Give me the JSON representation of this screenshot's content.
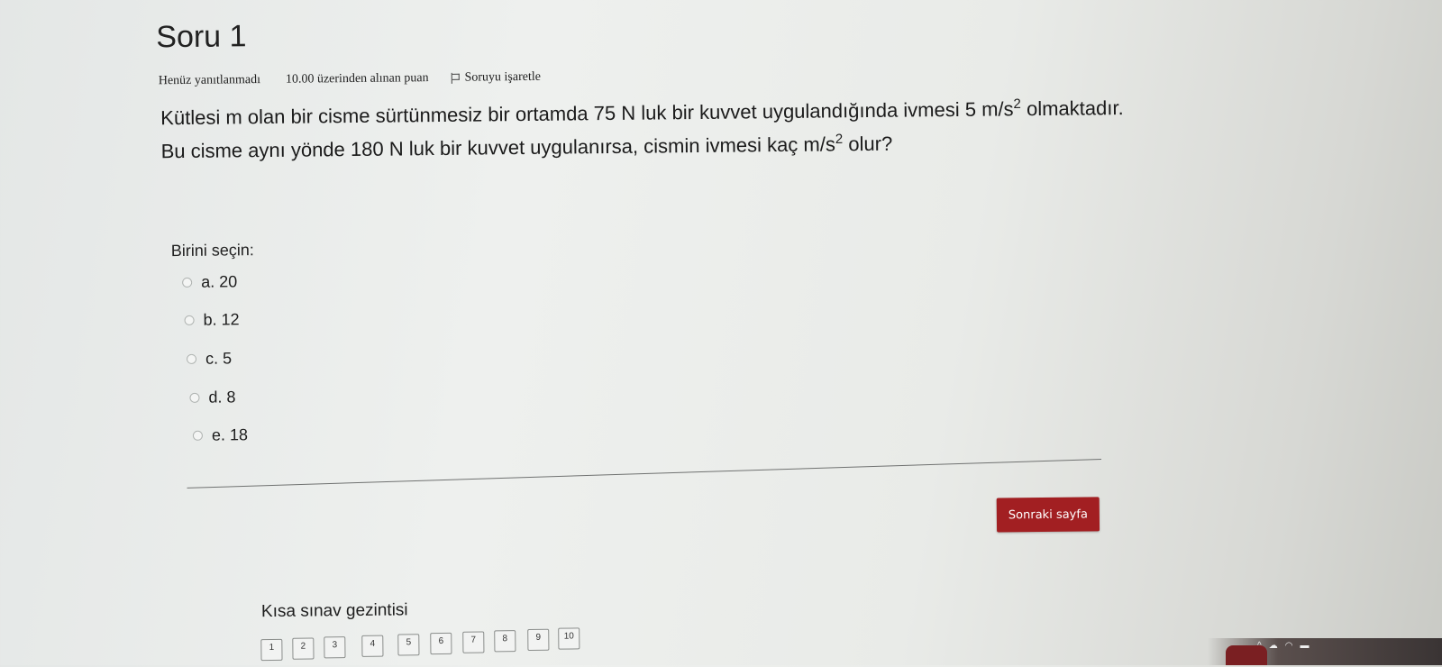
{
  "question": {
    "title": "Soru 1",
    "status": "Henüz yanıtlanmadı",
    "points": "10.00 üzerinden alınan puan",
    "flag_label": "Soruyu işaretle",
    "text_part1": "Kütlesi m olan bir cisme sürtünmesiz bir ortamda 75 N luk bir kuvvet uygulandığında ivmesi 5 m/s",
    "sup1": "2",
    "text_part2": " olmaktadır. Bu cisme aynı yönde 180 N luk bir kuvvet uygulanırsa, cismin ivmesi kaç m/s",
    "sup2": "2",
    "text_part3": " olur?"
  },
  "choose_label": "Birini seçin:",
  "options": [
    {
      "label": "a. 20"
    },
    {
      "label": "b. 12"
    },
    {
      "label": "c. 5"
    },
    {
      "label": "d. 8"
    },
    {
      "label": "e. 18"
    }
  ],
  "next_button": "Sonraki sayfa",
  "quiz_nav": {
    "title": "Kısa sınav gezintisi",
    "pages": [
      "1",
      "2",
      "3",
      "4",
      "5",
      "6",
      "7",
      "8",
      "9",
      "10"
    ]
  },
  "colors": {
    "next_button_bg": "#a21f22",
    "background": "#eceeec"
  },
  "icons": {
    "flag": "flag-icon",
    "radio": "radio-icon"
  }
}
